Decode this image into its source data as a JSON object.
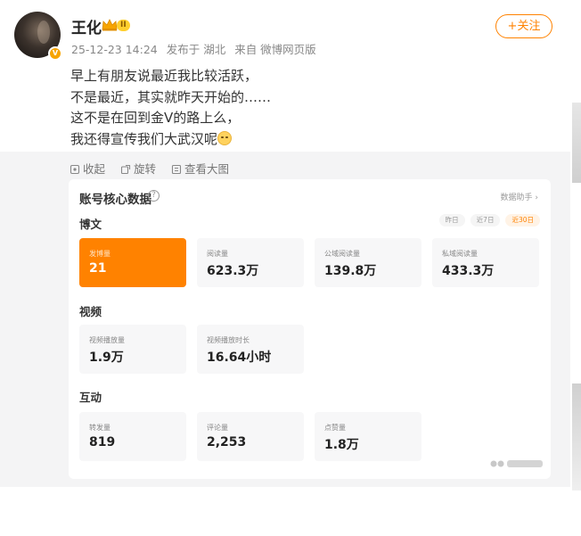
{
  "user": {
    "name": "王化",
    "level": "II",
    "verified_mark": "V"
  },
  "meta": {
    "timestamp": "25-12-23 14:24",
    "location": "发布于 湖北",
    "source": "来自 微博网页版"
  },
  "follow_label": "+关注",
  "post": {
    "lines": [
      "早上有朋友说最近我比较活跃，",
      "不是最近，其实就昨天开始的……",
      "这不是在回到金V的路上么，",
      "我还得宣传我们大武汉呢"
    ]
  },
  "image_tools": {
    "collapse": "收起",
    "rotate": "旋转",
    "view_large": "查看大图"
  },
  "dashboard": {
    "title": "账号核心数据",
    "help_icon": "?",
    "helper": "数据助手 ›",
    "weibo_section": "博文",
    "range_tabs": [
      "昨日",
      "近7日",
      "近30日"
    ],
    "active_range": "近30日",
    "weibo_stats": [
      {
        "label": "发博量",
        "value": "21"
      },
      {
        "label": "阅读量",
        "value": "623.3万"
      },
      {
        "label": "公域阅读量",
        "value": "139.8万"
      },
      {
        "label": "私域阅读量",
        "value": "433.3万"
      }
    ],
    "video_section": "视频",
    "video_stats": [
      {
        "label": "视频播放量",
        "value": "1.9万"
      },
      {
        "label": "视频播放时长",
        "value": "16.64小时"
      }
    ],
    "interaction_section": "互动",
    "interaction_stats": [
      {
        "label": "转发量",
        "value": "819"
      },
      {
        "label": "评论量",
        "value": "2,253"
      },
      {
        "label": "点赞量",
        "value": "1.8万"
      }
    ]
  },
  "colors": {
    "accent": "#ff8200",
    "meta_gray": "#888888",
    "panel_bg": "#f4f4f5"
  },
  "icons": [
    "crown-icon",
    "collapse-icon",
    "rotate-icon",
    "view-large-icon",
    "help-icon",
    "emoji-icon"
  ]
}
